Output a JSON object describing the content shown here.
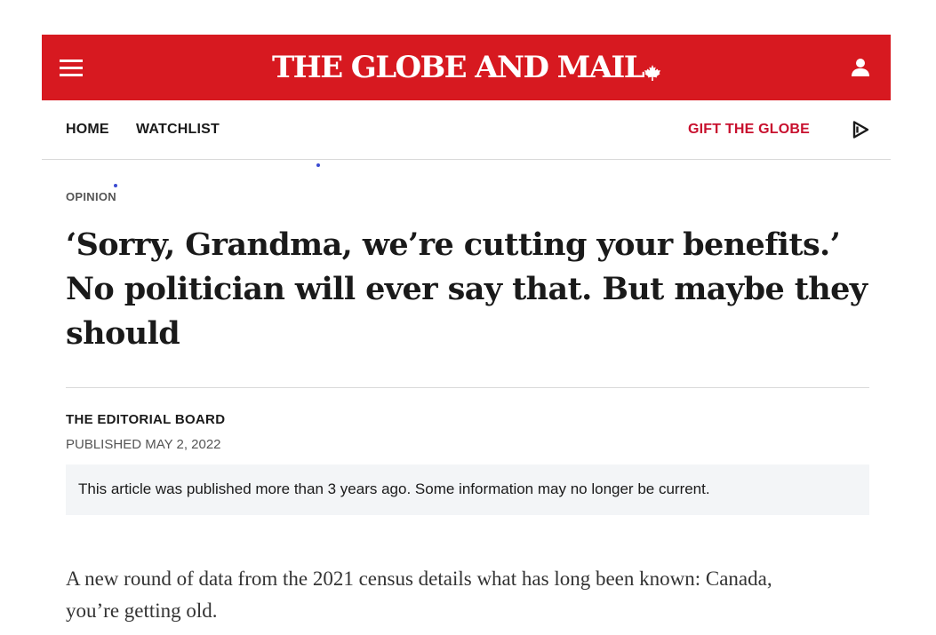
{
  "masthead": {
    "logo_text": "THE GLOBE AND MAIL",
    "logo_mark": "maple-leaf-icon",
    "menu_icon": "hamburger-menu-icon",
    "account_icon": "user-account-icon",
    "brand_color": "#d71920"
  },
  "nav": {
    "home": "HOME",
    "watchlist": "WATCHLIST",
    "gift": "GIFT THE GLOBE",
    "gift_color": "#c8102e",
    "play_icon": "play-icon"
  },
  "article": {
    "section": "OPINION",
    "headline": "‘Sorry, Grandma, we’re cutting your benefits.’ No politician will ever say that. But maybe they should",
    "author": "THE EDITORIAL BOARD",
    "published": "PUBLISHED MAY 2, 2022",
    "notice": "This article was published more than 3 years ago. Some information may no longer be current.",
    "lead_paragraph": "A new round of data from the 2021 census details what has long been known: Canada, you’re getting old."
  }
}
